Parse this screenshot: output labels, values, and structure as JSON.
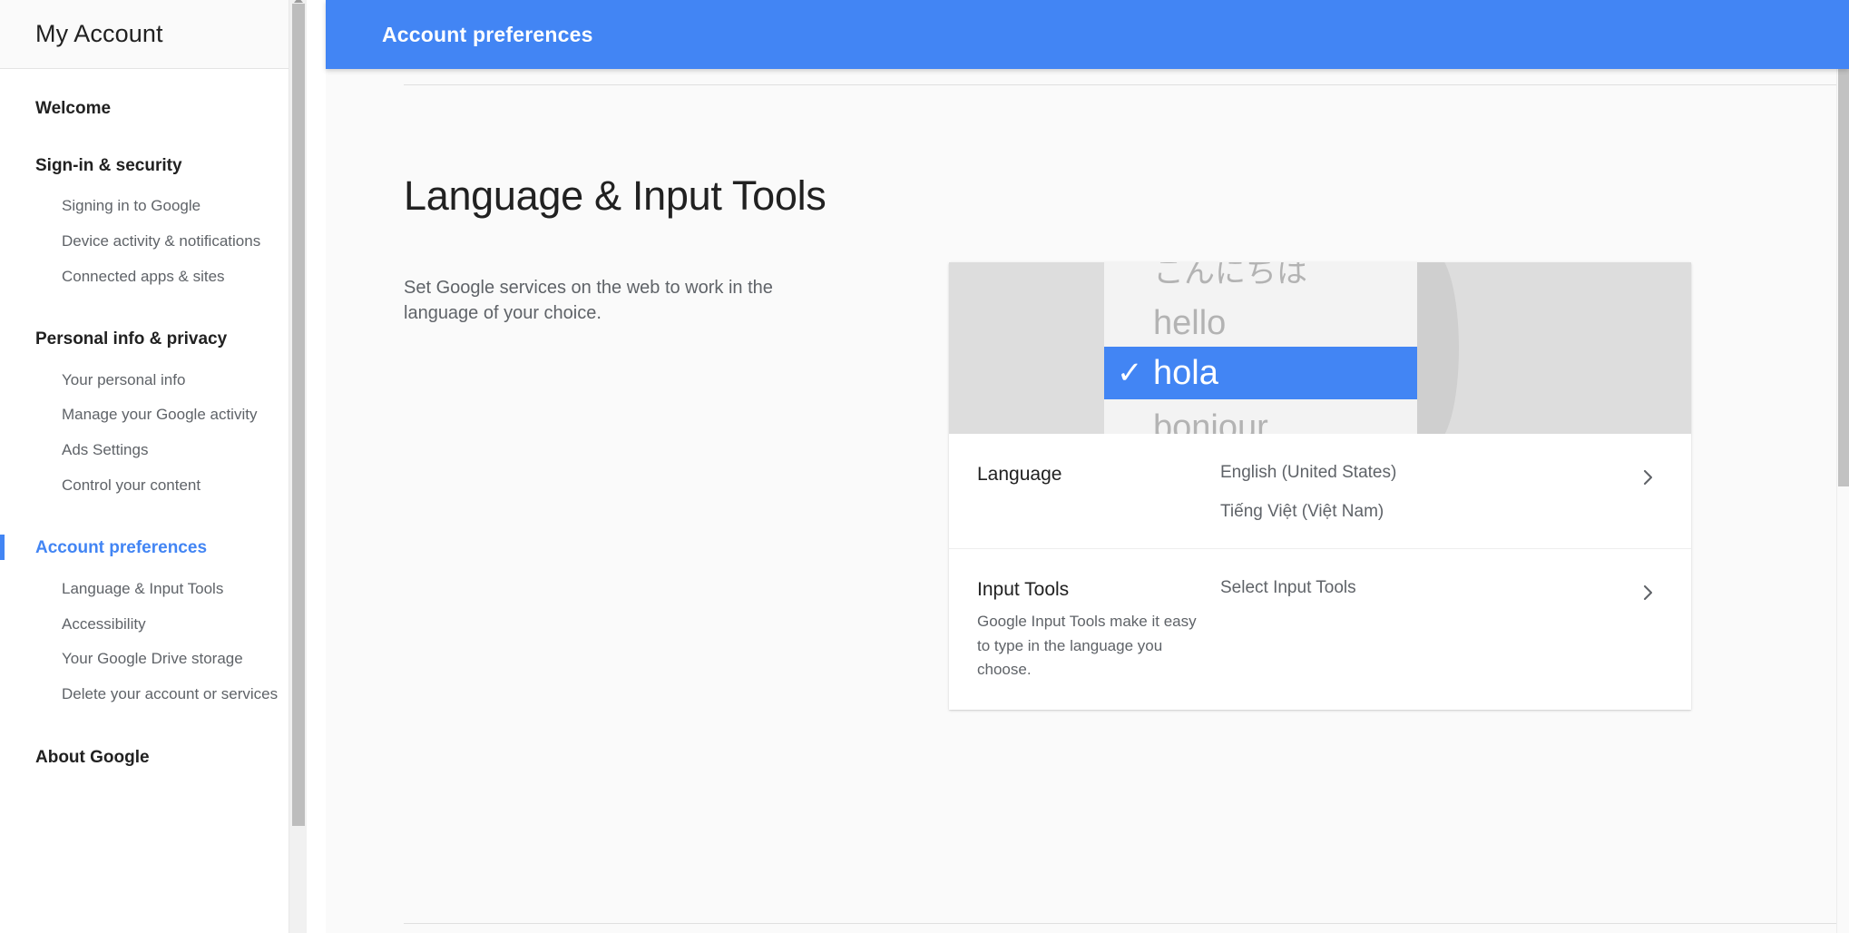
{
  "sidebar": {
    "brand": "My Account",
    "groups": [
      {
        "label": "Welcome",
        "active": false,
        "items": []
      },
      {
        "label": "Sign-in & security",
        "active": false,
        "items": [
          "Signing in to Google",
          "Device activity & notifications",
          "Connected apps & sites"
        ]
      },
      {
        "label": "Personal info & privacy",
        "active": false,
        "items": [
          "Your personal info",
          "Manage your Google activity",
          "Ads Settings",
          "Control your content"
        ]
      },
      {
        "label": "Account preferences",
        "active": true,
        "items": [
          "Language & Input Tools",
          "Accessibility",
          "Your Google Drive storage",
          "Delete your account or services"
        ]
      },
      {
        "label": "About Google",
        "active": false,
        "items": []
      }
    ]
  },
  "topbar": {
    "title": "Account preferences"
  },
  "page": {
    "title": "Language & Input Tools",
    "description": "Set Google services on the web to work in the language of your choice."
  },
  "card": {
    "hero": {
      "items": [
        {
          "word": "こんにちは",
          "selected": false
        },
        {
          "word": "hello",
          "selected": false
        },
        {
          "word": "hola",
          "selected": true
        },
        {
          "word": "bonjour",
          "selected": false
        }
      ],
      "check_glyph": "✓"
    },
    "rows": [
      {
        "label": "Language",
        "sub": "",
        "values": [
          "English (United States)",
          "Tiếng Việt (Việt Nam)"
        ]
      },
      {
        "label": "Input Tools",
        "sub": "Google Input Tools make it easy to type in the language you choose.",
        "values": [
          "Select Input Tools"
        ]
      }
    ]
  },
  "colors": {
    "accent": "#4285F4",
    "header_bg": "#4285F4",
    "text_primary": "#212121",
    "text_secondary": "#5F6368",
    "hero_bg": "#DDDDDD",
    "hero_panel": "#F3F3F3",
    "page_bg": "#FAFAFA"
  }
}
